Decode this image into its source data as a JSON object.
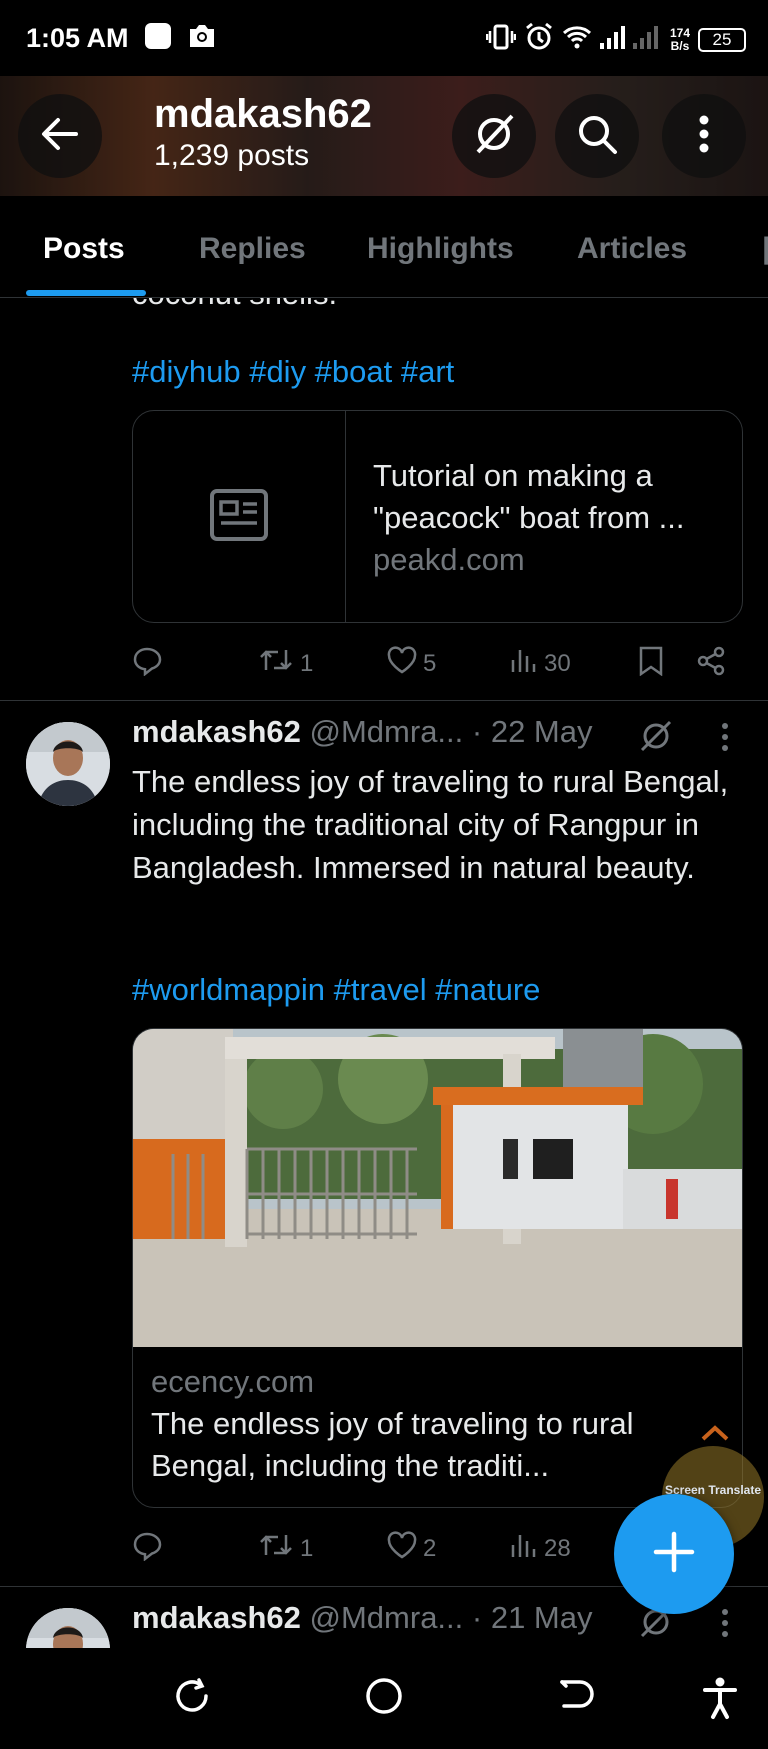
{
  "status_bar": {
    "time": "1:05 AM",
    "net_speed_value": "174",
    "net_speed_unit": "B/s",
    "battery": "25"
  },
  "header": {
    "title": "mdakash62",
    "post_count": "1,239 posts"
  },
  "tabs": [
    {
      "label": "Posts",
      "active": true
    },
    {
      "label": "Replies",
      "active": false
    },
    {
      "label": "Highlights",
      "active": false
    },
    {
      "label": "Articles",
      "active": false
    }
  ],
  "posts": [
    {
      "cut_text": "coconut shells.",
      "hashtags": "#diyhub #diy #boat #art",
      "link_card": {
        "title": "Tutorial on making a \"peacock\" boat from ...",
        "domain": "peakd.com"
      },
      "stats": {
        "replies": "",
        "reposts": "1",
        "likes": "5",
        "views": "30"
      }
    },
    {
      "username": "mdakash62",
      "handle": "@Mdmra...",
      "date": "· 22 May",
      "text": "The endless joy of traveling to rural Bengal, including the traditional city of Rangpur in Bangladesh. Immersed in natural beauty.",
      "hashtags": "#worldmappin #travel #nature",
      "link_card": {
        "domain": "ecency.com",
        "title": "The endless joy of traveling to rural Bengal, including the traditi..."
      },
      "stats": {
        "replies": "",
        "reposts": "1",
        "likes": "2",
        "views": "28"
      }
    },
    {
      "username": "mdakash62",
      "handle": "@Mdmra...",
      "date": "· 21 May"
    }
  ],
  "overlays": {
    "screen_translate_label": "Screen Translate"
  },
  "colors": {
    "accent": "#1d9bf0",
    "muted": "#71767b",
    "text": "#e7e9ea",
    "background": "#000000"
  }
}
